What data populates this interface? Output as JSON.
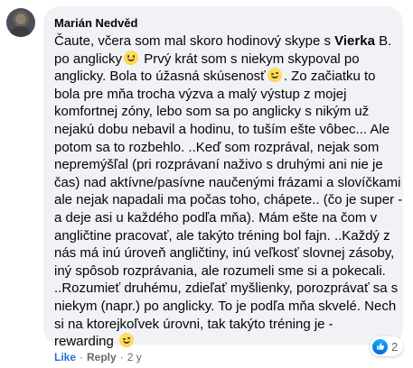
{
  "comment": {
    "author": "Marián Nedvěd",
    "lines": [
      {
        "pre": "Čaute, včera som mal skoro hodinový skype s ",
        "bold": "Vierka",
        "post": " B."
      },
      {
        "pre": "po anglicky",
        "emoji": "smile",
        "post": " Prvý krát som s niekym skypoval po"
      },
      {
        "pre": "anglicky. Bola to úžasná skúsenosť",
        "emoji": "wink",
        "post": ". Zo začiatku to"
      },
      {
        "pre": "bola pre mňa trocha výzva a malý výstup z mojej"
      },
      {
        "pre": "komfortnej zóny, lebo som sa po anglicky s nikým už"
      },
      {
        "pre": "nejakú dobu nebavil a hodinu, to tuším ešte vôbec... Ale"
      },
      {
        "pre": "potom sa to rozbehlo. ..Keď som rozprával, nejak som"
      },
      {
        "pre": "nepremýšľal (pri rozprávaní naživo s druhými ani nie je"
      },
      {
        "pre": "čas) nad aktívne/pasívne naučenými frázami a slovíčkami"
      },
      {
        "pre": "ale nejak napadali ma počas toho, chápete.. (čo je super -"
      },
      {
        "pre": "a deje asi u každého podľa mňa). Mám ešte na čom v"
      },
      {
        "pre": "angličtine pracovať, ale takýto tréning bol fajn. ..Každý z"
      },
      {
        "pre": "nás má inú úroveň angličtiny, inú veľkosť slovnej zásoby,"
      },
      {
        "pre": "iný spôsob rozprávania, ale rozumeli sme si a pokecali."
      },
      {
        "pre": "..Rozumieť druhému, zdieľať myšlienky, porozprávať sa s"
      },
      {
        "pre": "niekym (napr.) po anglicky. To je podľa mňa skvelé. Nech"
      },
      {
        "pre": "si na ktorejkoľvek úrovni, tak takýto tréning je -"
      },
      {
        "pre": "rewarding ",
        "emoji": "wink",
        "post": ""
      }
    ]
  },
  "reactions": {
    "count": "2",
    "icon": "like-icon",
    "color": "#1877f2"
  },
  "actions": {
    "like": "Like",
    "reply": "Reply",
    "separator": "·",
    "time": "2 y"
  }
}
